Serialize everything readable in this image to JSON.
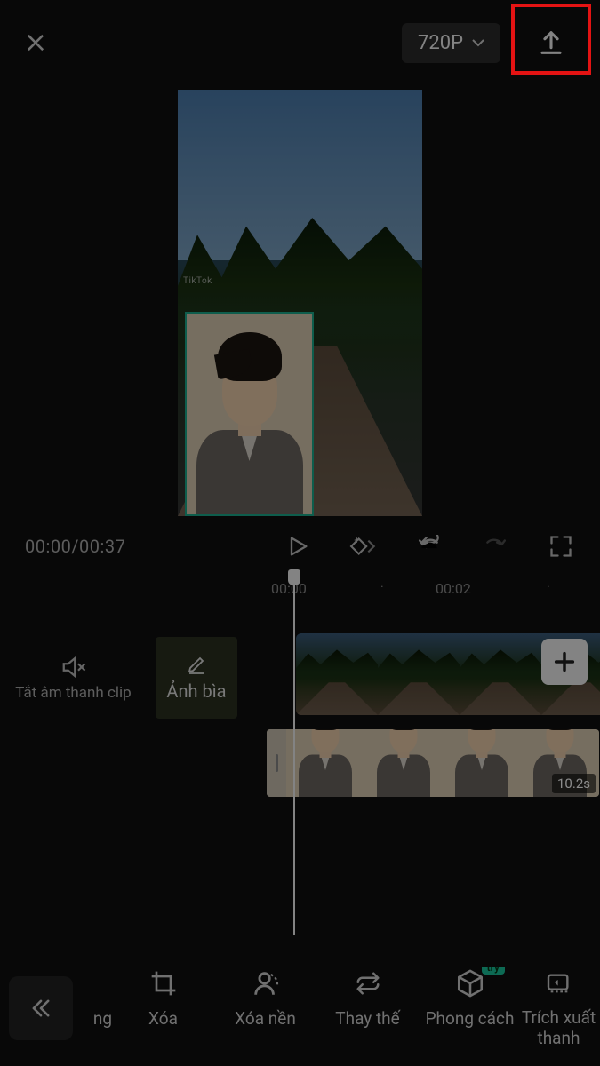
{
  "header": {
    "resolution_label": "720P",
    "close_action": "close",
    "export_action": "export"
  },
  "preview": {
    "watermark": "TikTok",
    "overlay_selected": true
  },
  "playback": {
    "current_time": "00:00",
    "total_time": "00:37",
    "time_display": "00:00/00:37"
  },
  "ruler": {
    "marks": [
      "00:00",
      "00:02"
    ]
  },
  "timeline": {
    "mute_label": "Tắt âm thanh clip",
    "cover_label": "Ảnh bìa",
    "overlay_duration": "10.2s"
  },
  "toolbar": {
    "partial_left_label": "ng",
    "items": [
      {
        "label": "Xóa",
        "icon": "crop"
      },
      {
        "label": "Xóa nền",
        "icon": "cutout"
      },
      {
        "label": "Thay thế",
        "icon": "repeat"
      },
      {
        "label": "Phong cách",
        "icon": "cube",
        "badge": "try"
      },
      {
        "label": "Trích xuất thanh",
        "icon": "extract"
      }
    ]
  }
}
